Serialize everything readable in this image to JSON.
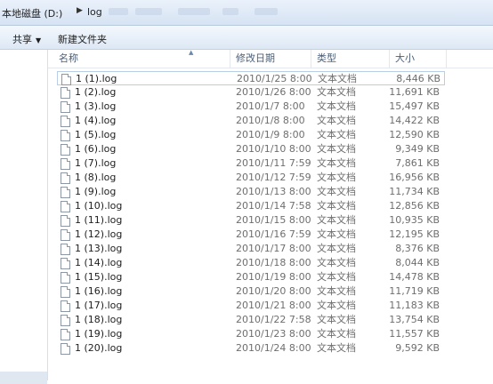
{
  "address": {
    "path": [
      "本地磁盘 (D:)",
      "log"
    ]
  },
  "toolbar": {
    "share_label": "共享",
    "new_folder_label": "新建文件夹"
  },
  "columns": {
    "name": "名称",
    "date": "修改日期",
    "type": "类型",
    "size": "大小"
  },
  "files": [
    {
      "name": "1 (1).log",
      "date": "2010/1/25 8:00",
      "type": "文本文档",
      "size": "8,446 KB"
    },
    {
      "name": "1 (2).log",
      "date": "2010/1/26 8:00",
      "type": "文本文档",
      "size": "11,691 KB"
    },
    {
      "name": "1 (3).log",
      "date": "2010/1/7 8:00",
      "type": "文本文档",
      "size": "15,497 KB"
    },
    {
      "name": "1 (4).log",
      "date": "2010/1/8 8:00",
      "type": "文本文档",
      "size": "14,422 KB"
    },
    {
      "name": "1 (5).log",
      "date": "2010/1/9 8:00",
      "type": "文本文档",
      "size": "12,590 KB"
    },
    {
      "name": "1 (6).log",
      "date": "2010/1/10 8:00",
      "type": "文本文档",
      "size": "9,349 KB"
    },
    {
      "name": "1 (7).log",
      "date": "2010/1/11 7:59",
      "type": "文本文档",
      "size": "7,861 KB"
    },
    {
      "name": "1 (8).log",
      "date": "2010/1/12 7:59",
      "type": "文本文档",
      "size": "16,956 KB"
    },
    {
      "name": "1 (9).log",
      "date": "2010/1/13 8:00",
      "type": "文本文档",
      "size": "11,734 KB"
    },
    {
      "name": "1 (10).log",
      "date": "2010/1/14 7:58",
      "type": "文本文档",
      "size": "12,856 KB"
    },
    {
      "name": "1 (11).log",
      "date": "2010/1/15 8:00",
      "type": "文本文档",
      "size": "10,935 KB"
    },
    {
      "name": "1 (12).log",
      "date": "2010/1/16 7:59",
      "type": "文本文档",
      "size": "12,195 KB"
    },
    {
      "name": "1 (13).log",
      "date": "2010/1/17 8:00",
      "type": "文本文档",
      "size": "8,376 KB"
    },
    {
      "name": "1 (14).log",
      "date": "2010/1/18 8:00",
      "type": "文本文档",
      "size": "8,044 KB"
    },
    {
      "name": "1 (15).log",
      "date": "2010/1/19 8:00",
      "type": "文本文档",
      "size": "14,478 KB"
    },
    {
      "name": "1 (16).log",
      "date": "2010/1/20 8:00",
      "type": "文本文档",
      "size": "11,719 KB"
    },
    {
      "name": "1 (17).log",
      "date": "2010/1/21 8:00",
      "type": "文本文档",
      "size": "11,183 KB"
    },
    {
      "name": "1 (18).log",
      "date": "2010/1/22 7:58",
      "type": "文本文档",
      "size": "13,754 KB"
    },
    {
      "name": "1 (19).log",
      "date": "2010/1/23 8:00",
      "type": "文本文档",
      "size": "11,557 KB"
    },
    {
      "name": "1 (20).log",
      "date": "2010/1/24 8:00",
      "type": "文本文档",
      "size": "9,592 KB"
    }
  ],
  "icons": {
    "file": "text-document-icon",
    "breadcrumb_separator": "chevron-right-icon",
    "dropdown": "caret-down-icon",
    "sort": "sort-ascending-icon"
  }
}
